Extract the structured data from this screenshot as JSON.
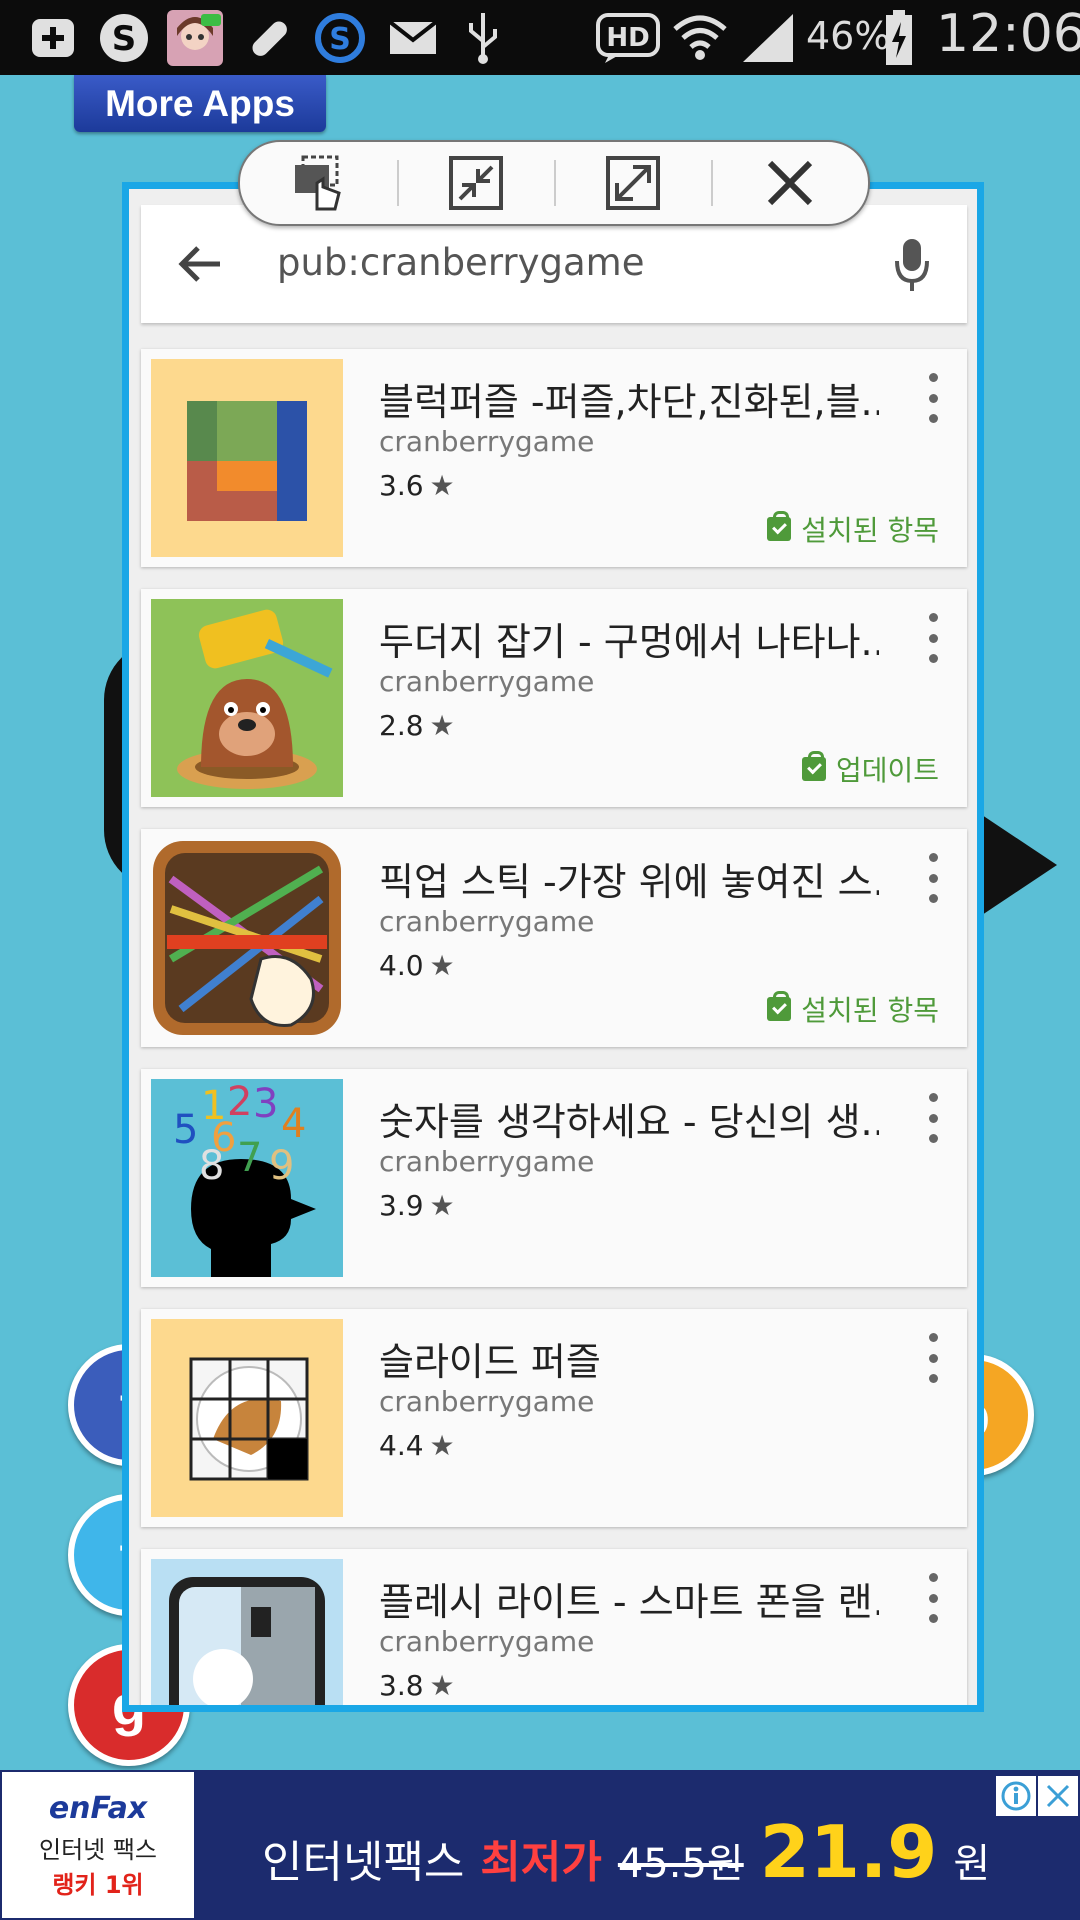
{
  "statusbar": {
    "battery": "46%",
    "time": "12:06",
    "hd_label": "HD",
    "icons": [
      "add-icon",
      "skype-icon",
      "line-avatar-icon",
      "bandage-icon",
      "s-app-icon",
      "mail-icon",
      "usb-icon",
      "hd-icon",
      "wifi-icon",
      "signal-icon",
      "battery-icon"
    ]
  },
  "background_app": {
    "more_apps_label": "More Apps"
  },
  "window": {
    "toolbar": {
      "buttons": [
        "drag-window-icon",
        "minimize-window-icon",
        "maximize-window-icon",
        "close-window-icon"
      ]
    },
    "search": {
      "query": "pub:cranberrygame"
    },
    "apps": [
      {
        "title": "블럭퍼즐 -퍼즐,차단,진화된,블..",
        "developer": "cranberrygame",
        "rating": "3.6",
        "status": "설치된 항목",
        "icon": "block-puzzle-icon"
      },
      {
        "title": "두더지 잡기 - 구멍에서 나타나..",
        "developer": "cranberrygame",
        "rating": "2.8",
        "status": "업데이트",
        "icon": "mole-hammer-icon"
      },
      {
        "title": "픽업 스틱 -가장 위에 놓여진 스..",
        "developer": "cranberrygame",
        "rating": "4.0",
        "status": "설치된 항목",
        "icon": "pickup-sticks-icon"
      },
      {
        "title": "숫자를 생각하세요 - 당신의 생..",
        "developer": "cranberrygame",
        "rating": "3.9",
        "status": "",
        "icon": "number-head-icon"
      },
      {
        "title": "슬라이드 퍼즐",
        "developer": "cranberrygame",
        "rating": "4.4",
        "status": "",
        "icon": "slide-puzzle-icon"
      },
      {
        "title": "플레시 라이트 - 스마트 폰을 랜..",
        "developer": "cranberrygame",
        "rating": "3.8",
        "status": "",
        "icon": "flashlight-icon"
      }
    ],
    "thumb_numbers": [
      "1",
      "2",
      "3",
      "4",
      "5",
      "6",
      "7",
      "8",
      "9"
    ]
  },
  "ad": {
    "brand": "enFax",
    "brand_line1": "인터넷 팩스",
    "brand_line2": "랭키 1위",
    "text_main": "인터넷팩스",
    "text_highlight": "최저가",
    "old_price": "45.5원",
    "new_price": "21.9",
    "price_unit": "원",
    "colors": {
      "highlight": "#ff4040",
      "price": "#ffd21a",
      "brand_red": "#e2231a"
    }
  }
}
